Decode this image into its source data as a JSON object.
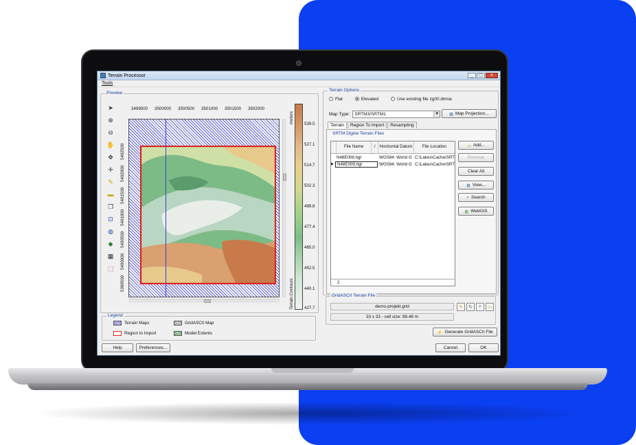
{
  "window": {
    "title": "Terrain Processor",
    "menu_tools": "Tools",
    "min": "_",
    "max": "▢",
    "close": "✕"
  },
  "preview": {
    "label": "Preview",
    "x_ticks": [
      "3499500",
      "3500000",
      "3500500",
      "3501000",
      "3501500",
      "3502000"
    ],
    "y_ticks": [
      "5402500",
      "5402000",
      "5401500",
      "5401000",
      "5400500",
      "5400000",
      "5399500"
    ]
  },
  "contour_scale": {
    "unit": "meters",
    "title": "Terrain Contours",
    "ticks": [
      "539.5",
      "527.1",
      "514.7",
      "502.3",
      "489.8",
      "477.4",
      "465.0",
      "452.5",
      "440.1",
      "427.7"
    ]
  },
  "legend": {
    "label": "Legend",
    "terrain_maps": "Terrain Maps",
    "gridascii_map": "GridASCII Map",
    "region_to_import": "Region to Import",
    "model_extents": "Model Extents"
  },
  "terrain_options": {
    "label": "Terrain Options",
    "flat": "Flat",
    "elevated": "Elevated",
    "use_existing": "Use existing file zg00.dmna",
    "map_type_label": "Map Type:",
    "map_type_value": "SRTM3/SRTM1",
    "map_projection": "Map Projection..."
  },
  "tabs": [
    "Terrain",
    "Region To Import",
    "Resampling"
  ],
  "srtm": {
    "label": "SRTM Digital Terrain Files",
    "headers": {
      "file_name": "File Name",
      "sort": "/",
      "datum": "Horizontal Datum",
      "location": "File Location"
    },
    "rows": [
      {
        "file": "N48E008.hgt",
        "datum": "WGS84: World G",
        "location": "C:\\Lakes\\Cache\\SRT"
      },
      {
        "file": "N48E009.hgt",
        "datum": "WGS84: World G",
        "location": "C:\\Lakes\\Cache\\SRT"
      }
    ],
    "count": "2",
    "buttons": {
      "add": "Add...",
      "remove": "Remove",
      "clear_all": "Clear All",
      "view": "View...",
      "search": "Search",
      "webgis": "WebGIS"
    }
  },
  "gridascii": {
    "label": "GridASCII Terrain File",
    "file": "demo-projekt.grid",
    "info": "33 x 33 - cell size: 98.48 m",
    "generate": "Generate GridASCII File"
  },
  "footer": {
    "help": "Help",
    "preferences": "Preferences...",
    "cancel": "Cancel",
    "ok": "OK"
  },
  "colors": {
    "accent_blue": "#0b3ff2",
    "region_red": "#e02020",
    "title_blue": "#1a3fa0"
  }
}
